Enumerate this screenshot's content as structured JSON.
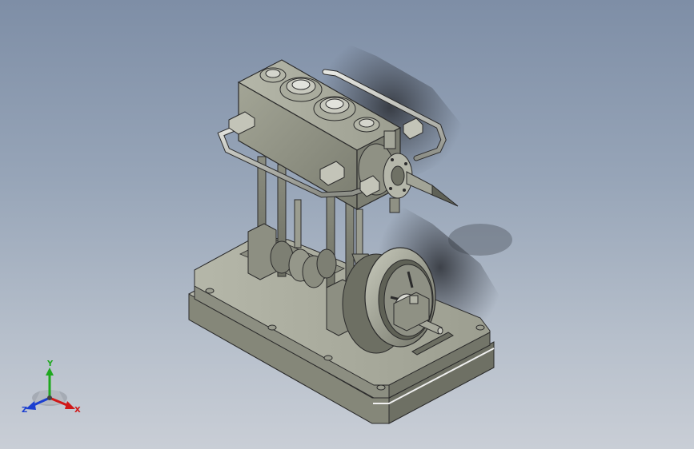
{
  "viewport": {
    "background_top": "#7e8ea6",
    "background_bottom": "#c9ced6"
  },
  "model": {
    "icon": "steam-engine-3d-model",
    "body_color": "#8f9184",
    "edge_color": "#2b2b2b"
  },
  "triad": {
    "icon": "coordinate-axis-triad",
    "x_label": "X",
    "y_label": "Y",
    "z_label": "Z",
    "x_color": "#d01818",
    "y_color": "#1fa81f",
    "z_color": "#1b3fd0"
  }
}
